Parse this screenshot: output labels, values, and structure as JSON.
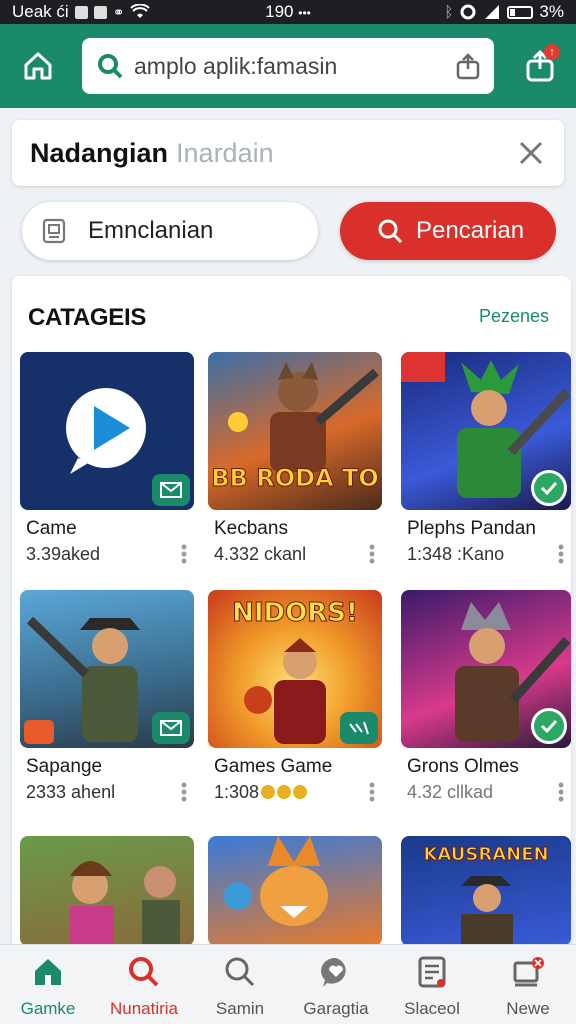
{
  "status_bar": {
    "left": "Ueak ći",
    "time": "190",
    "battery": "3%"
  },
  "header": {
    "search_value": "",
    "search_placeholder": "amplo aplik:famasin"
  },
  "search_card": {
    "title": "Nadangian",
    "placeholder": "Inardain"
  },
  "buttons": {
    "secondary_label": "Emnclanian",
    "primary_label": "Pencarian"
  },
  "section": {
    "title": "CATAGEIS",
    "link": "Pezenes"
  },
  "tiles": [
    {
      "name": "Came",
      "meta": "3.39aked",
      "badge": "mail-badge-icon",
      "banner": ""
    },
    {
      "name": "Kecbans",
      "meta": "4.332 ckanl",
      "badge": "",
      "banner": "BB RODA TO"
    },
    {
      "name": "Plephs Pandan",
      "meta": "1:348 :Kano",
      "badge": "check-badge-icon",
      "banner": ""
    },
    {
      "name": "Sapange",
      "meta": "2333 ahenl",
      "badge": "mail-badge-icon",
      "banner": ""
    },
    {
      "name": "Games Game",
      "meta": "1:308",
      "badge": "chart-badge-icon",
      "banner": "NIDORS!"
    },
    {
      "name": "Grons Olmes",
      "meta": "4.32 cllkad",
      "badge": "check-badge-icon",
      "banner": ""
    },
    {
      "name": "",
      "meta": "",
      "badge": "",
      "banner": ""
    },
    {
      "name": "",
      "meta": "",
      "badge": "",
      "banner": ""
    },
    {
      "name": "",
      "meta": "",
      "badge": "",
      "banner": "KAUSRANEN"
    }
  ],
  "bottom_nav": [
    {
      "label": "Gamke",
      "icon": "home-icon"
    },
    {
      "label": "Nunatiria",
      "icon": "search-icon"
    },
    {
      "label": "Samin",
      "icon": "search-icon"
    },
    {
      "label": "Garagtia",
      "icon": "chat-heart-icon"
    },
    {
      "label": "Slaceol",
      "icon": "document-icon"
    },
    {
      "label": "Newe",
      "icon": "device-icon"
    }
  ],
  "colors": {
    "brand": "#1a8a6a",
    "accent": "#d9302b",
    "check": "#2aa864"
  }
}
